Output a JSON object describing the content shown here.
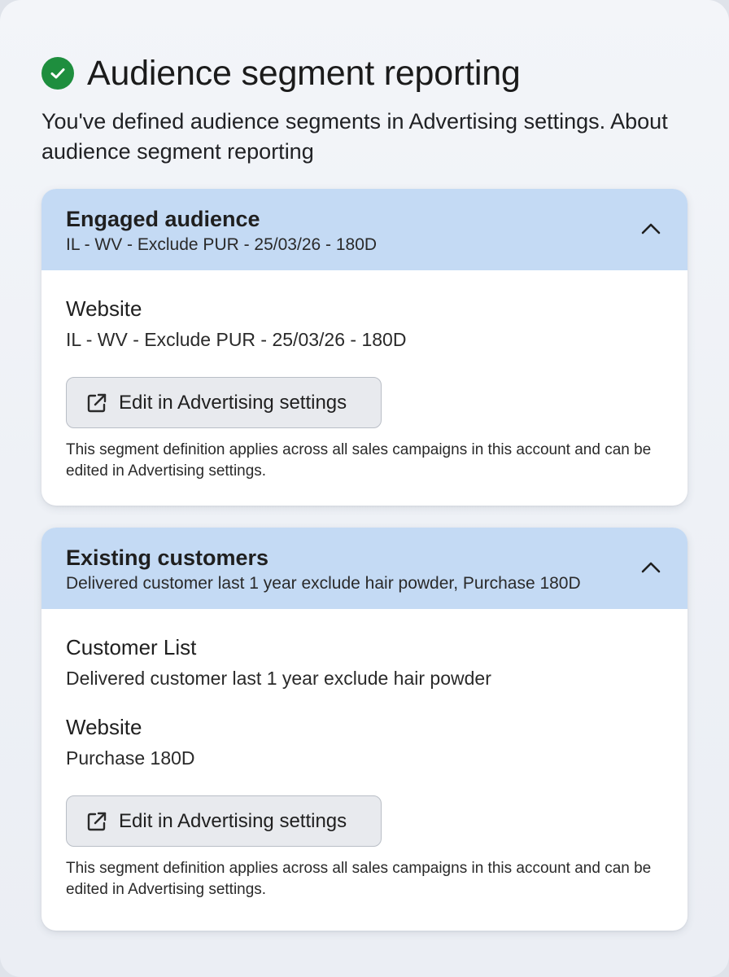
{
  "header": {
    "icon": "check-circle-icon",
    "icon_color": "#1e8e3e",
    "title": "Audience segment reporting",
    "subtitle_text": "You've defined audience segments in Advertising settings.",
    "subtitle_link": "About audience segment reporting"
  },
  "colors": {
    "card_header_bg": "#c4daf4",
    "button_bg": "#e8eaee",
    "success": "#1e8e3e"
  },
  "segments": [
    {
      "title": "Engaged audience",
      "summary": "IL - WV - Exclude PUR - 25/03/26 - 180D",
      "expanded": true,
      "items": [
        {
          "label": "Website",
          "value": "IL - WV - Exclude PUR - 25/03/26 - 180D"
        }
      ],
      "button_label": "Edit in Advertising settings",
      "button_icon": "external-link-icon",
      "note": "This segment definition applies across all sales campaigns in this account and can be edited in Advertising settings."
    },
    {
      "title": "Existing customers",
      "summary": "Delivered customer last 1 year exclude hair powder, Purchase 180D",
      "expanded": true,
      "items": [
        {
          "label": "Customer List",
          "value": "Delivered customer last 1 year exclude hair powder"
        },
        {
          "label": "Website",
          "value": "Purchase 180D"
        }
      ],
      "button_label": "Edit in Advertising settings",
      "button_icon": "external-link-icon",
      "note": "This segment definition applies across all sales campaigns in this account and can be edited in Advertising settings."
    }
  ]
}
